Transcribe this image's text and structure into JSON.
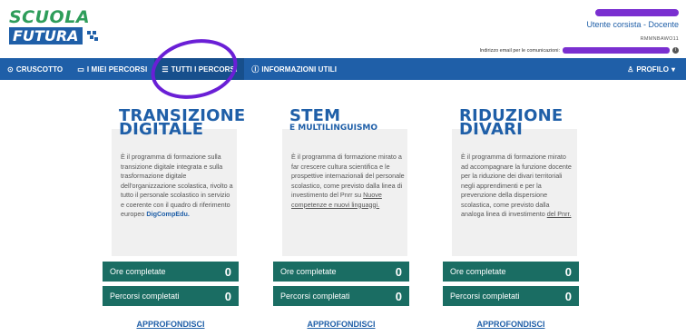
{
  "logo": {
    "line1": "SCUOLA",
    "line2": "FUTURA"
  },
  "user": {
    "role": "Utente corsista - Docente",
    "code": "RMMNBAWO11",
    "email_label": "Indirizzo email per le comunicazioni:"
  },
  "nav": {
    "items": [
      {
        "icon": "⊙",
        "label": "CRUSCOTTO"
      },
      {
        "icon": "▭",
        "label": "I MIEI PERCORSI"
      },
      {
        "icon": "☰",
        "label": "TUTTI I PERCORSI"
      },
      {
        "icon": "ⓘ",
        "label": "INFORMAZIONI UTILI"
      }
    ],
    "profile_label": "PROFILO",
    "profile_icon": "♙",
    "profile_caret": "▾"
  },
  "cards": [
    {
      "title_line1": "TRANSIZIONE",
      "title_line2": "DIGITALE",
      "subtitle": "",
      "text": "È il programma di formazione sulla transizione digitale integrata e sulla trasformazione digitale dell'organizzazione scolastica, rivolto a tutto il personale scolastico in servizio e coerente con il quadro di riferimento europeo",
      "text_strong": "DigCompEdu.",
      "stat1_label": "Ore completate",
      "stat1_value": "0",
      "stat2_label": "Percorsi completati",
      "stat2_value": "0",
      "cta": "APPROFONDISCI"
    },
    {
      "title_line1": "STEM",
      "title_line2": "",
      "subtitle": "E MULTILINGUISMO",
      "text": "È il programma di formazione mirato a far crescere cultura scientifica e le prospettive internazionali del personale scolastico, come previsto dalla linea di investimento del Pnrr su",
      "text_link": "Nuove competenze e nuovi linguaggi.",
      "stat1_label": "Ore completate",
      "stat1_value": "0",
      "stat2_label": "Percorsi completati",
      "stat2_value": "0",
      "cta": "APPROFONDISCI"
    },
    {
      "title_line1": "RIDUZIONE",
      "title_line2": "DIVARI",
      "subtitle": "",
      "text": "È il programma di formazione mirato ad accompagnare la funzione docente per la riduzione dei divari territoriali negli apprendimenti e per la prevenzione della dispersione scolastica, come previsto dalla analoga linea di investimento",
      "text_link": "del Pnrr.",
      "stat1_label": "Ore completate",
      "stat1_value": "0",
      "stat2_label": "Percorsi completati",
      "stat2_value": "0",
      "cta": "APPROFONDISCI"
    }
  ],
  "colors": {
    "brand_blue": "#1f5fa8",
    "teal": "#1a6d63",
    "green": "#2e9d5a",
    "annotation": "#6a1fd6"
  }
}
